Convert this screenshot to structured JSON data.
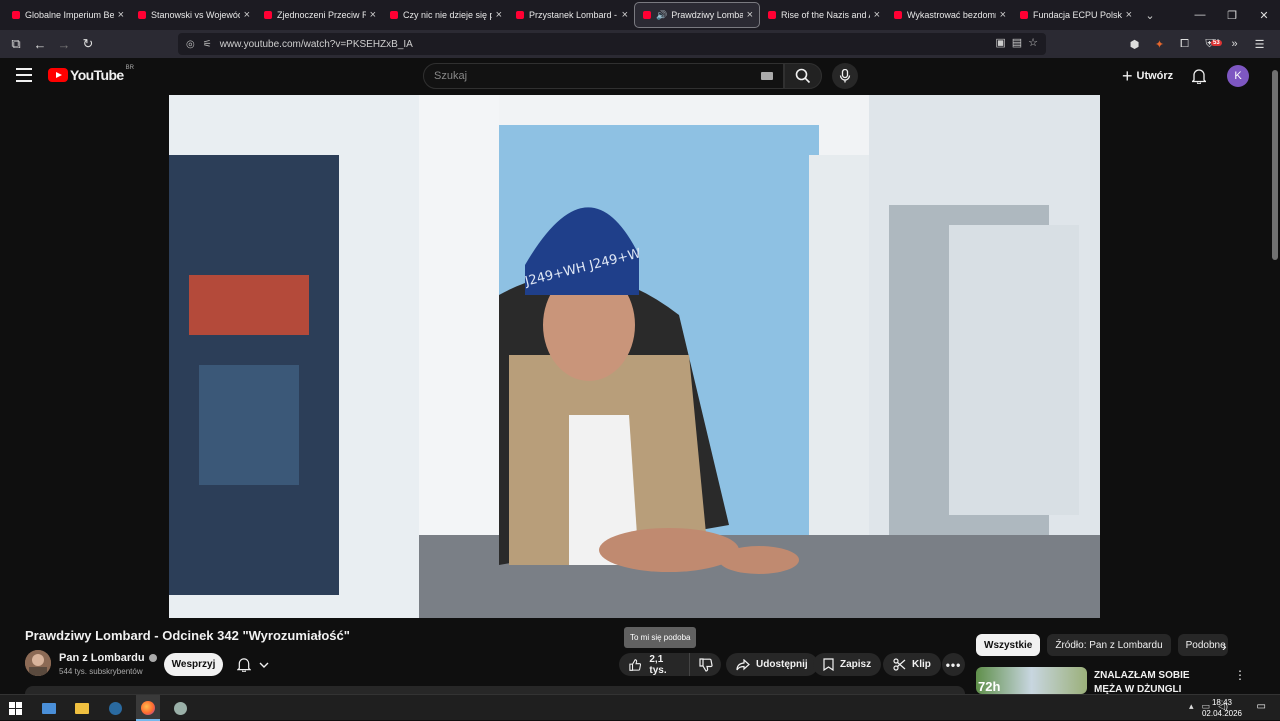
{
  "browser": {
    "tabs": [
      {
        "title": "Globalne Imperium Bezk",
        "active": false,
        "audio": false
      },
      {
        "title": "Stanowski vs Województ",
        "active": false,
        "audio": false
      },
      {
        "title": "Zjednoczeni Przeciw Ras",
        "active": false,
        "audio": false
      },
      {
        "title": "Czy nic nie dzieje się prz",
        "active": false,
        "audio": false
      },
      {
        "title": "Przystanek Lombard - Od",
        "active": false,
        "audio": false
      },
      {
        "title": "Prawdziwy Lombard",
        "active": true,
        "audio": true
      },
      {
        "title": "Rise of the Nazis and Ad",
        "active": false,
        "audio": false
      },
      {
        "title": "Wykastrować bezdomno",
        "active": false,
        "audio": false
      },
      {
        "title": "Fundacja ECPU Polska: K",
        "active": false,
        "audio": false
      }
    ],
    "url": "www.youtube.com/watch?v=PKSEHZxB_IA",
    "extension_badge": "53"
  },
  "youtube": {
    "logo_text": "YouTube",
    "country_code": "BR",
    "search_placeholder": "Szukaj",
    "create_label": "Utwórz",
    "avatar_letter": "K"
  },
  "video": {
    "title": "Prawdziwy Lombard - Odcinek 342 \"Wyrozumiałość\"",
    "channel_name": "Pan z Lombardu",
    "subscribers": "544 tys. subskrybentów",
    "support_label": "Wesprzyj",
    "like_count": "2,1 tys.",
    "like_tooltip": "To mi się podoba",
    "share_label": "Udostępnij",
    "save_label": "Zapisz",
    "clip_label": "Klip"
  },
  "sidebar": {
    "chips": [
      {
        "label": "Wszystkie",
        "selected": true
      },
      {
        "label": "Źródło: Pan z Lombardu",
        "selected": false
      },
      {
        "label": "Podobne",
        "selected": false
      }
    ],
    "recommendation": {
      "title": "ZNALAZŁAM SOBIE MĘŻA W DŻUNGLI",
      "thumb_text": "72h"
    }
  },
  "taskbar": {
    "time": "18:43",
    "date": "02.04.2026"
  },
  "colors": {
    "yt_red": "#ff0000",
    "avatar": "#7e57c2",
    "background": "#0f0f0f"
  }
}
